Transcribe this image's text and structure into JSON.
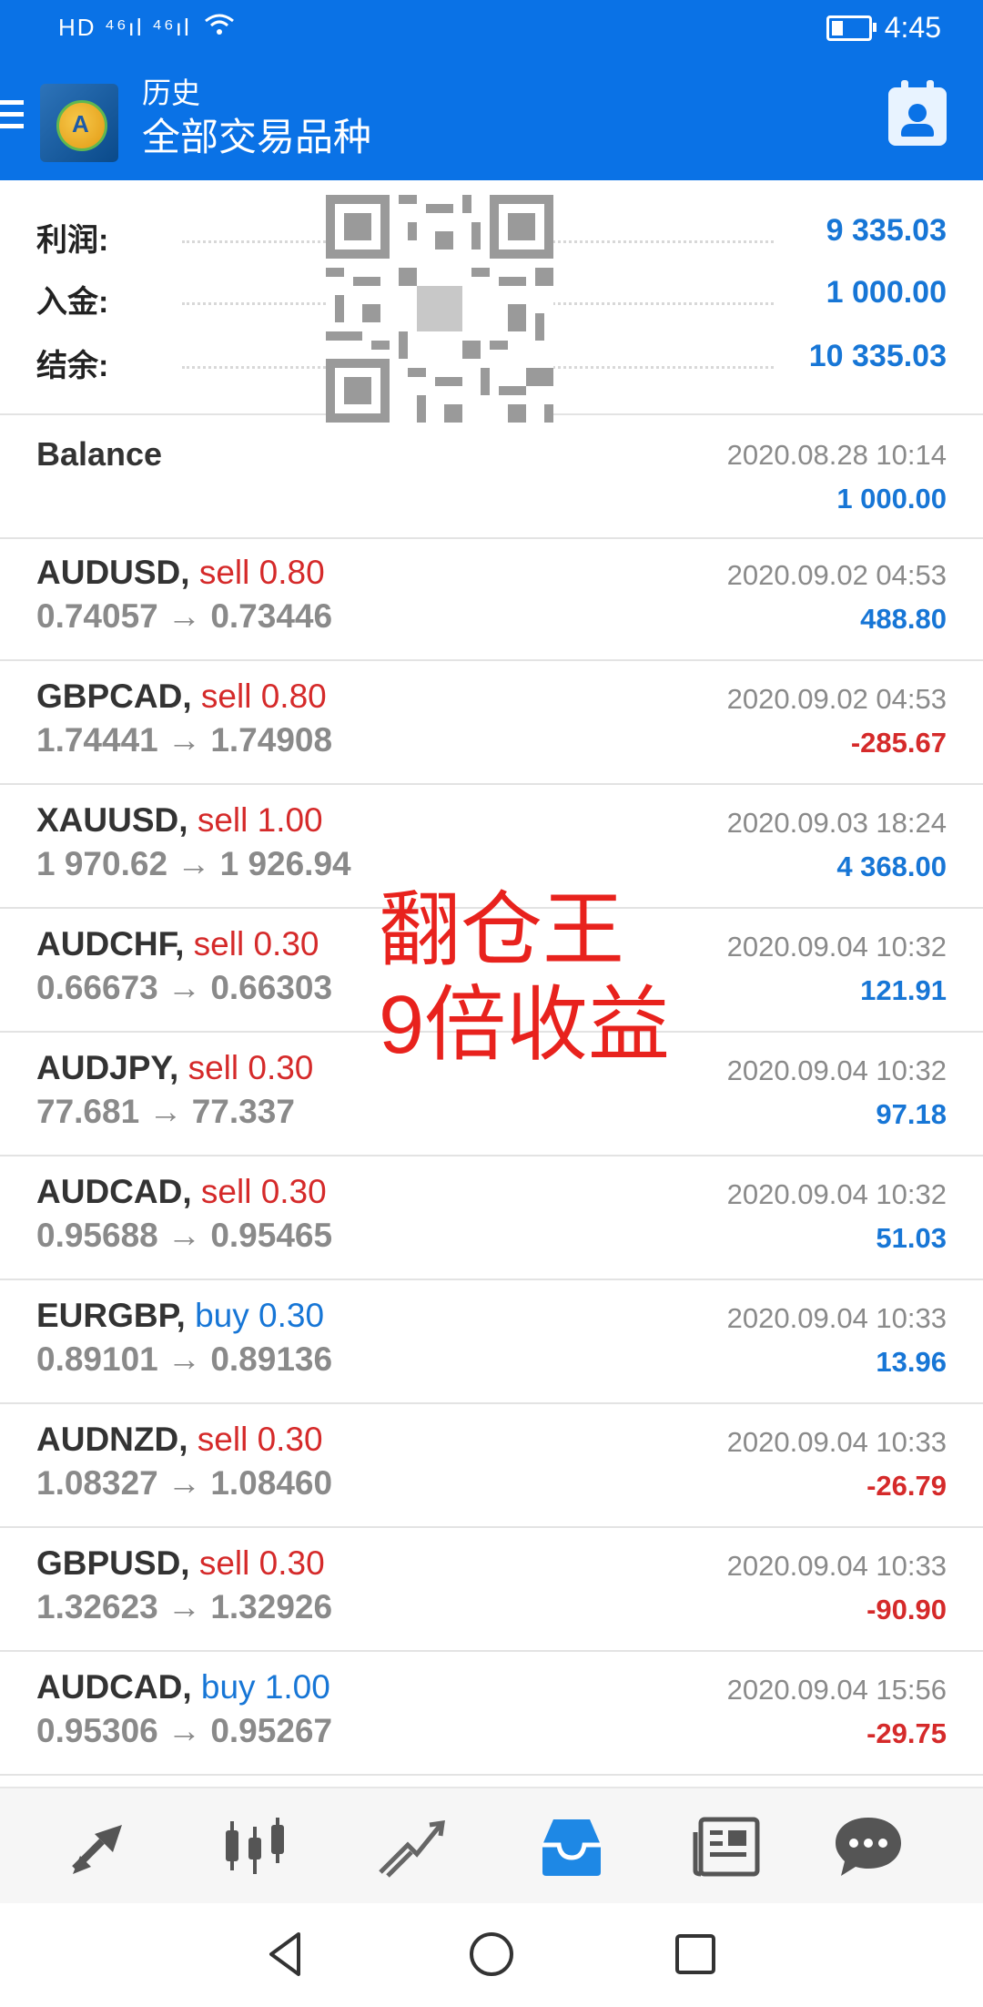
{
  "status": {
    "network": "HD ⁴⁶ıl ⁴⁶ıl",
    "time": "4:45"
  },
  "app": {
    "title_small": "历史",
    "title_large": "全部交易品种"
  },
  "summary": {
    "profit_label": "利润:",
    "profit_value": "9 335.03",
    "deposit_label": "入金:",
    "deposit_value": "1 000.00",
    "balance_label": "结余:",
    "balance_value": "10 335.03"
  },
  "balance_entry": {
    "name": "Balance",
    "time": "2020.08.28 10:14",
    "amount": "1 000.00"
  },
  "trades": [
    {
      "symbol": "AUDUSD,",
      "side": "sell",
      "lot": "0.80",
      "open": "0.74057",
      "close": "0.73446",
      "time": "2020.09.02 04:53",
      "profit": "488.80"
    },
    {
      "symbol": "GBPCAD,",
      "side": "sell",
      "lot": "0.80",
      "open": "1.74441",
      "close": "1.74908",
      "time": "2020.09.02 04:53",
      "profit": "-285.67"
    },
    {
      "symbol": "XAUUSD,",
      "side": "sell",
      "lot": "1.00",
      "open": "1 970.62",
      "close": "1 926.94",
      "time": "2020.09.03 18:24",
      "profit": "4 368.00"
    },
    {
      "symbol": "AUDCHF,",
      "side": "sell",
      "lot": "0.30",
      "open": "0.66673",
      "close": "0.66303",
      "time": "2020.09.04 10:32",
      "profit": "121.91"
    },
    {
      "symbol": "AUDJPY,",
      "side": "sell",
      "lot": "0.30",
      "open": "77.681",
      "close": "77.337",
      "time": "2020.09.04 10:32",
      "profit": "97.18"
    },
    {
      "symbol": "AUDCAD,",
      "side": "sell",
      "lot": "0.30",
      "open": "0.95688",
      "close": "0.95465",
      "time": "2020.09.04 10:32",
      "profit": "51.03"
    },
    {
      "symbol": "EURGBP,",
      "side": "buy",
      "lot": "0.30",
      "open": "0.89101",
      "close": "0.89136",
      "time": "2020.09.04 10:33",
      "profit": "13.96"
    },
    {
      "symbol": "AUDNZD,",
      "side": "sell",
      "lot": "0.30",
      "open": "1.08327",
      "close": "1.08460",
      "time": "2020.09.04 10:33",
      "profit": "-26.79"
    },
    {
      "symbol": "GBPUSD,",
      "side": "sell",
      "lot": "0.30",
      "open": "1.32623",
      "close": "1.32926",
      "time": "2020.09.04 10:33",
      "profit": "-90.90"
    },
    {
      "symbol": "AUDCAD,",
      "side": "buy",
      "lot": "1.00",
      "open": "0.95306",
      "close": "0.95267",
      "time": "2020.09.04 15:56",
      "profit": "-29.75"
    }
  ],
  "arrow": "→",
  "overlay": {
    "line1": "翻仓王",
    "line2": "9倍收益"
  },
  "nav_icons": [
    "quotes-icon",
    "chart-icon",
    "trade-icon",
    "history-icon",
    "news-icon",
    "chat-icon"
  ],
  "colors": {
    "accent": "#0a72e6",
    "positive": "#1776d6",
    "negative": "#d52a2a",
    "overlay": "#e8221d"
  }
}
